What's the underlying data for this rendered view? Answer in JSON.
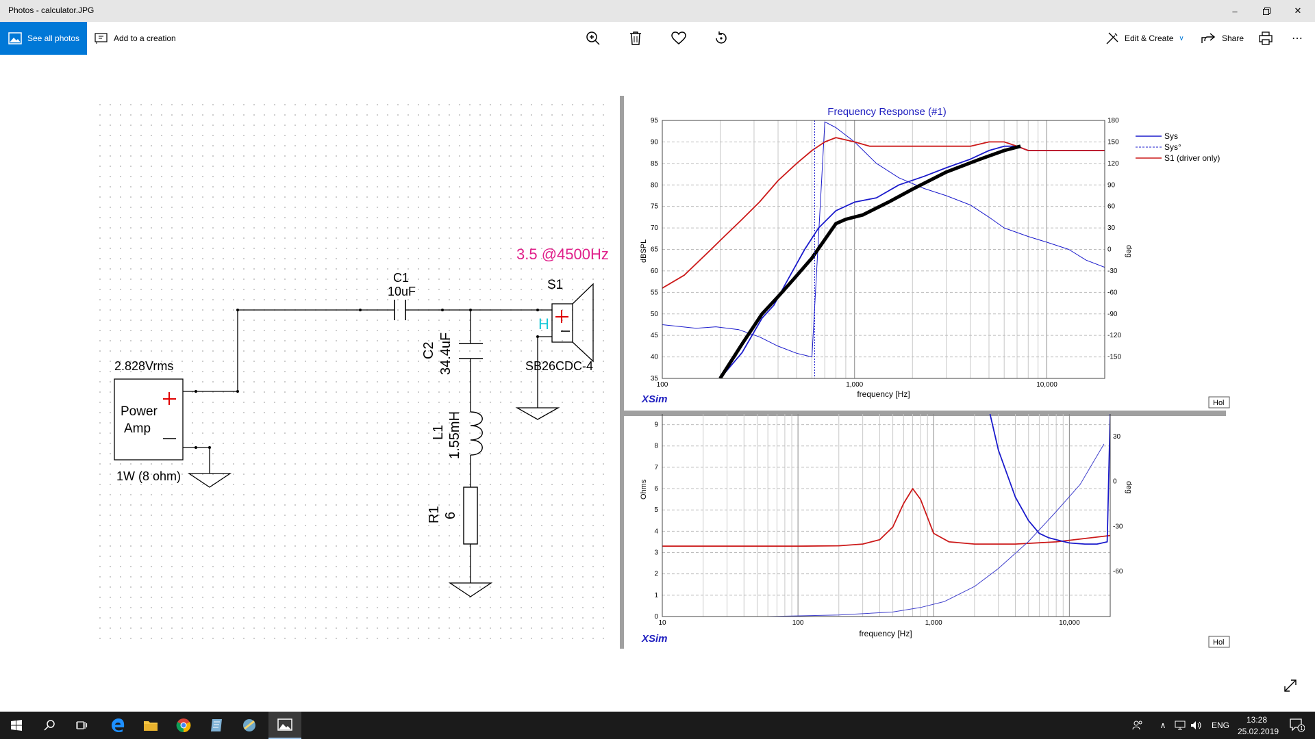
{
  "window": {
    "title": "Photos - calculator.JPG"
  },
  "toolbar": {
    "see_all": "See all photos",
    "add_creation": "Add to a creation",
    "edit_create": "Edit & Create",
    "share": "Share"
  },
  "schematic": {
    "c1_name": "C1",
    "c1_value": "10uF",
    "c2_name": "C2",
    "c2_value": "34.4uF",
    "l1_name": "L1",
    "l1_value": "1.55mH",
    "r1_name": "R1",
    "r1_value": "6",
    "s1_name": "S1",
    "s1_model": "SB26CDC-4",
    "s1_h": "H",
    "amp_voltage": "2.828Vrms",
    "amp_line1": "Power",
    "amp_line2": "Amp",
    "amp_power": "1W (8 ohm)",
    "annotation": "3.5 @4500Hz"
  },
  "fr_chart": {
    "title": "Frequency Response (#1)",
    "ylabel": "dBSPL",
    "y2label": "deg",
    "xlabel": "frequency [Hz]",
    "y_ticks": [
      "95",
      "90",
      "85",
      "80",
      "75",
      "70",
      "65",
      "60",
      "55",
      "50",
      "45",
      "40",
      "35"
    ],
    "y2_ticks": [
      "180",
      "150",
      "120",
      "90",
      "60",
      "30",
      "0",
      "-30",
      "-60",
      "-90",
      "-120",
      "-150"
    ],
    "x_ticks": [
      "100",
      "1,000",
      "10,000"
    ],
    "legend": [
      "Sys",
      "Sys°",
      "S1 (driver only)"
    ],
    "brand": "XSim",
    "hold": "Hol"
  },
  "imp_chart": {
    "ylabel": "Ohms",
    "y2label": "deg",
    "xlabel": "frequency [Hz]",
    "y_ticks": [
      "9",
      "8",
      "7",
      "6",
      "5",
      "4",
      "3",
      "2",
      "1",
      "0"
    ],
    "y2_ticks": [
      "30",
      "0",
      "-30",
      "-60"
    ],
    "x_ticks": [
      "10",
      "100",
      "1,000",
      "10,000"
    ],
    "brand": "XSim",
    "hold": "Hol"
  },
  "chart_data": [
    {
      "type": "line",
      "title": "Frequency Response (#1)",
      "xlabel": "frequency [Hz]",
      "ylabel": "dBSPL",
      "y2label": "deg",
      "xscale": "log",
      "xlim": [
        100,
        20000
      ],
      "ylim": [
        35,
        95
      ],
      "y2lim": [
        -180,
        180
      ],
      "grid": true,
      "legend": "top-right",
      "series": [
        {
          "name": "Sys",
          "color": "#1a1acc",
          "x": [
            200,
            260,
            330,
            380,
            450,
            550,
            650,
            800,
            1000,
            1300,
            1700,
            2300,
            3000,
            4000,
            5000,
            6000,
            7000,
            8000,
            10000,
            13000,
            16000,
            20000
          ],
          "y": [
            35,
            41,
            49,
            52,
            58,
            65,
            70,
            74,
            76,
            77,
            80,
            82,
            84,
            86,
            88,
            89,
            89,
            88,
            88,
            88,
            88,
            88
          ]
        },
        {
          "name": "Sys°",
          "color": "#1a1acc",
          "axis": "y2",
          "x": [
            100,
            150,
            190,
            250,
            320,
            400,
            500,
            600,
            700,
            800,
            1000,
            1300,
            1700,
            2300,
            3000,
            4000,
            5000,
            6000,
            8000,
            10000,
            13000,
            16000,
            20000
          ],
          "y": [
            -105,
            -110,
            -108,
            -112,
            -122,
            -135,
            -145,
            -150,
            178,
            170,
            150,
            120,
            100,
            85,
            75,
            62,
            45,
            30,
            18,
            10,
            0,
            -15,
            -25
          ]
        },
        {
          "name": "S1 (driver only)",
          "color": "#cc1a1a",
          "x": [
            100,
            130,
            170,
            210,
            260,
            320,
            400,
            500,
            600,
            700,
            800,
            1000,
            1200,
            1500,
            2000,
            3000,
            4000,
            5000,
            6000,
            7000,
            8000,
            10000,
            13000,
            16000,
            20000
          ],
          "y": [
            56,
            59,
            64,
            68,
            72,
            76,
            81,
            85,
            88,
            90,
            91,
            90,
            89,
            89,
            89,
            89,
            89,
            90,
            90,
            89,
            88,
            88,
            88,
            88,
            88
          ]
        },
        {
          "name": "",
          "color": "#000000",
          "x": [
            200,
            260,
            330,
            400,
            480,
            600,
            800,
            900,
            1100,
            1500,
            2000,
            3000,
            4500,
            6000,
            7300
          ],
          "y": [
            35,
            43,
            50,
            54,
            58,
            63,
            71,
            72,
            73,
            76,
            79,
            83,
            86,
            88,
            89
          ]
        }
      ]
    },
    {
      "type": "line",
      "xlabel": "frequency [Hz]",
      "ylabel": "Ohms",
      "y2label": "deg",
      "xscale": "log",
      "xlim": [
        10,
        20000
      ],
      "ylim": [
        0,
        9.5
      ],
      "y2lim": [
        -90,
        45
      ],
      "grid": true,
      "series": [
        {
          "name": "S1 impedance",
          "color": "#cc1a1a",
          "x": [
            10,
            100,
            200,
            300,
            400,
            500,
            600,
            700,
            800,
            1000,
            1300,
            2000,
            4000,
            8000,
            20000
          ],
          "y": [
            3.3,
            3.3,
            3.32,
            3.4,
            3.6,
            4.2,
            5.3,
            6.0,
            5.5,
            3.9,
            3.5,
            3.4,
            3.4,
            3.5,
            3.8
          ]
        },
        {
          "name": "Sys impedance",
          "color": "#1a1acc",
          "x": [
            2600,
            3000,
            4000,
            5000,
            6000,
            7000,
            8000,
            10000,
            13000,
            16000,
            19000,
            20000
          ],
          "y": [
            9.5,
            7.8,
            5.6,
            4.5,
            3.9,
            3.7,
            3.6,
            3.45,
            3.4,
            3.4,
            3.5,
            9.5
          ]
        },
        {
          "name": "phase",
          "color": "#4040cc",
          "axis": "y2",
          "x": [
            60,
            200,
            500,
            800,
            1200,
            2000,
            3000,
            5000,
            8000,
            12000,
            18000
          ],
          "y": [
            -90,
            -89,
            -87,
            -84,
            -80,
            -70,
            -58,
            -40,
            -20,
            -2,
            25
          ]
        }
      ]
    }
  ]
}
